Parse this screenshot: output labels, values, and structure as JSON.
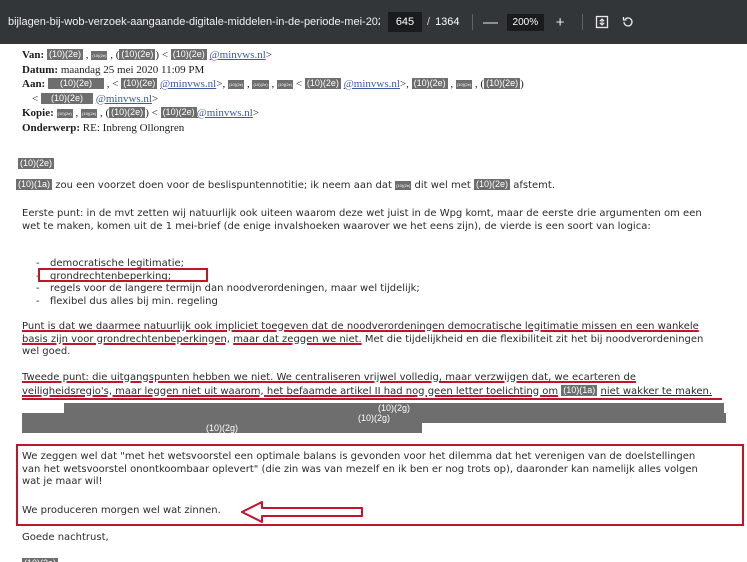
{
  "toolbar": {
    "filename": "bijlagen-bij-wob-verzoek-aangaande-digitale-middelen-in-de-periode-mei-2020-iii.pdf",
    "current_page": "645",
    "page_separator": "/",
    "total_pages": "1364",
    "zoom_out": "—",
    "zoom_level": "200%",
    "zoom_in": "+",
    "fit_icon": "fit-to-page-icon",
    "rotate_icon": "rotate-icon"
  },
  "redaction": {
    "code_2e": "(10)(2e)",
    "code_1a": "(10)(1a)",
    "code_2g": "(10)(2g)",
    "small": "(10)(2e)"
  },
  "header": {
    "van_label": "Van:",
    "datum_label": "Datum:",
    "datum_value": "maandag 25 mei 2020 11:09 PM",
    "aan_label": "Aan:",
    "kopie_label": "Kopie:",
    "onderwerp_label": "Onderwerp:",
    "onderwerp_value": "RE: Inbreng Ollongren",
    "domain": "@minvws.nl"
  },
  "email": {
    "p1_part1": "zou een voorzet doen voor de beslispuntennotitie; ik neem aan dat",
    "p1_part2": "dit wel met",
    "p1_part3": "afstemt.",
    "p2": "Eerste punt: in de mvt zetten wij natuurlijk ook uiteen waarom deze wet juist in de Wpg komt, maar de eerste drie argumenten om een wet te maken, komen uit de 1 mei-brief (de enige invalshoeken waarover we het eens zijn), de vierde is een soort van logica:",
    "bullets": [
      "democratische legitimatie;",
      "grondrechtenbeperking;",
      "regels voor de langere termijn dan noodverordeningen, maar wel tijdelijk;",
      "flexibel dus alles bij min. regeling"
    ],
    "p3_part1": "Punt is dat we daarmee natuurlijk ook impliciet toegeven dat de noodverordeningen democratische legitimatie missen en een wankele basis zijn voor grondrechtenbeperkingen,",
    "p3_part2": "maar dat zeggen we niet.",
    "p3_part3": "Met die tijdelijkheid en die flexibiliteit zit het bij noodverordeningen wel goed.",
    "p4_part1": "Tweede punt: die uitgangspunten hebben we niet. We centraliseren vrijwel volledig, maar verzwijgen dat, we ecarteren de veiligheidsregio's, maar leggen niet uit waarom, het befaamde artikel II had nog geen letter toelichting om",
    "p4_part2": "niet wakker te maken.",
    "p5": "We zeggen wel dat \"met het wetsvoorstel een optimale balans is gevonden voor het dilemma dat het verenigen van de doelstellingen van het wetsvoorstel onontkoombaar oplevert\" (die zin was van mezelf en ik ben er nog trots op), daaronder kan namelijk alles volgen wat je maar wil!",
    "p6": "We produceren morgen wel wat zinnen.",
    "closing": "Goede nachtrust,"
  },
  "colors": {
    "toolbar_bg": "#323639",
    "redaction": "#6e6e6e",
    "annotation_red": "#c0152a",
    "link": "#3a5aa8"
  }
}
